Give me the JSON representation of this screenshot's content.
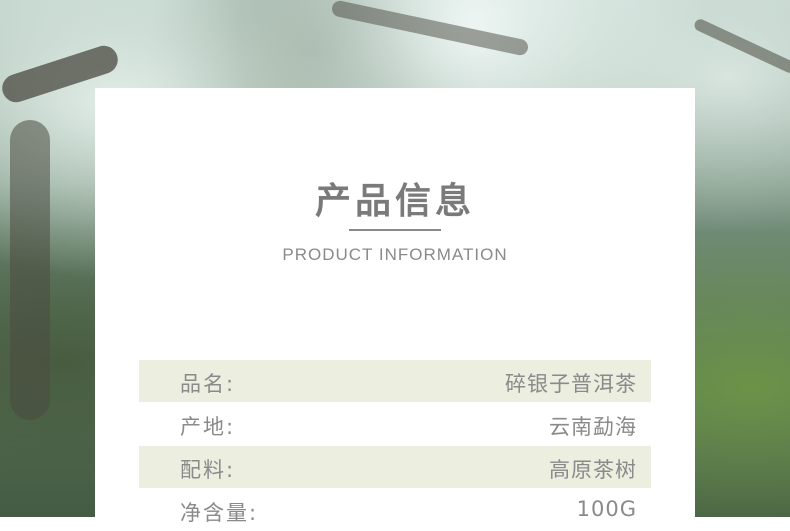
{
  "header": {
    "title": "产品信息",
    "subtitle": "PRODUCT INFORMATION"
  },
  "rows": [
    {
      "label": "品名:",
      "value": "碎银子普洱茶"
    },
    {
      "label": "产地:",
      "value": "云南勐海"
    },
    {
      "label": "配料:",
      "value": "高原茶树"
    },
    {
      "label": "净含量:",
      "value": "100G"
    }
  ],
  "colors": {
    "text": "#8a8a8a",
    "row_shade": "#eceee0",
    "card": "#ffffff"
  }
}
